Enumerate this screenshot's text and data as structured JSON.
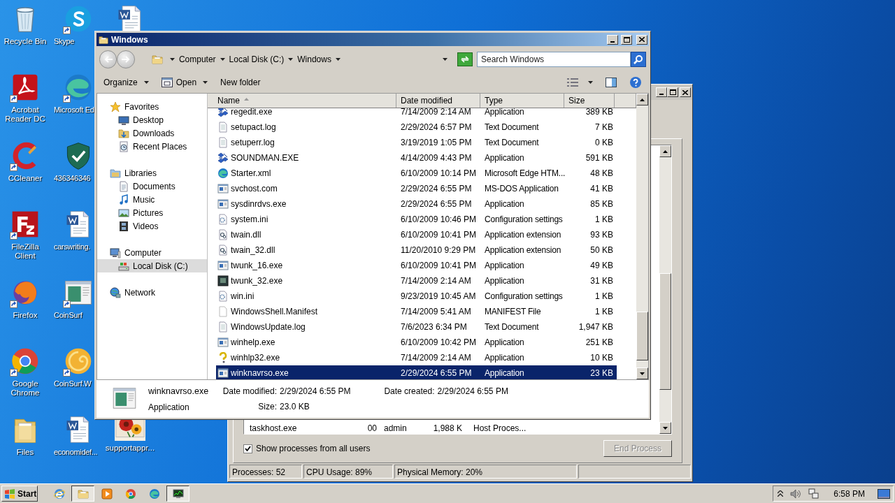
{
  "desktop": {
    "columns": [
      [
        {
          "label": "Recycle Bin",
          "kind": "recycle",
          "shortcut": false
        },
        {
          "label": "Acrobat Reader DC",
          "kind": "acrobat",
          "shortcut": true
        },
        {
          "label": "CCleaner",
          "kind": "ccleaner",
          "shortcut": true
        },
        {
          "label": "FileZilla Client",
          "kind": "filezilla",
          "shortcut": true
        },
        {
          "label": "Firefox",
          "kind": "firefox",
          "shortcut": true
        },
        {
          "label": "Google Chrome",
          "kind": "chrome",
          "shortcut": true
        },
        {
          "label": "Files",
          "kind": "folder",
          "shortcut": false
        }
      ],
      [
        {
          "label": "Skype",
          "kind": "skype",
          "shortcut": true
        },
        {
          "label": "Microsoft Ed",
          "kind": "edge",
          "shortcut": true
        },
        {
          "label": "436346346",
          "kind": "shield",
          "shortcut": false
        },
        {
          "label": "carswriting.",
          "kind": "word",
          "shortcut": false
        },
        {
          "label": "CoinSurf",
          "kind": "app",
          "shortcut": true
        },
        {
          "label": "CoinSurf.W",
          "kind": "coin",
          "shortcut": true
        },
        {
          "label": "economidef...",
          "kind": "word",
          "shortcut": false
        }
      ],
      [
        {
          "kind": "word",
          "shortcut": false
        },
        {
          "label": "supportappr...",
          "kind": "picture",
          "shortcut": false
        }
      ]
    ]
  },
  "task_manager": {
    "process_row": [
      "taskhost.exe",
      "00",
      "admin",
      "1,988 K",
      "Host Proces..."
    ],
    "show_all_users": {
      "label": "Show processes from all users",
      "checked": true
    },
    "end_process": {
      "label": "End Process",
      "disabled": true
    },
    "status_bar": [
      "Processes: 52",
      "CPU Usage: 89%",
      "Physical Memory: 20%"
    ]
  },
  "explorer": {
    "title": "Windows",
    "breadcrumb": [
      "Computer",
      "Local Disk (C:)",
      "Windows"
    ],
    "search": {
      "placeholder": "Search Windows"
    },
    "toolbar": [
      {
        "label": "Organize",
        "kind": "menu"
      },
      {
        "label": "Open",
        "kind": "open"
      },
      {
        "label": "New folder",
        "kind": "plain"
      }
    ],
    "sidebar": [
      {
        "label": "Favorites",
        "kind": "star",
        "selected": false,
        "children": [
          {
            "label": "Desktop",
            "kind": "desktop",
            "selected": false
          },
          {
            "label": "Downloads",
            "kind": "downloads",
            "selected": false
          },
          {
            "label": "Recent Places",
            "kind": "recent",
            "selected": false
          }
        ]
      },
      {
        "label": "Libraries",
        "kind": "libraries",
        "selected": false,
        "children": [
          {
            "label": "Documents",
            "kind": "doc",
            "selected": false
          },
          {
            "label": "Music",
            "kind": "music",
            "selected": false
          },
          {
            "label": "Pictures",
            "kind": "pictures",
            "selected": false
          },
          {
            "label": "Videos",
            "kind": "videos",
            "selected": false
          }
        ]
      },
      {
        "label": "Computer",
        "kind": "computer",
        "selected": false,
        "children": [
          {
            "label": "Local Disk (C:)",
            "kind": "disk",
            "selected": true
          }
        ]
      },
      {
        "label": "Network",
        "kind": "network",
        "selected": false
      }
    ],
    "columns": [
      {
        "label": "Name",
        "sorted": true
      },
      {
        "label": "Date modified",
        "sorted": false
      },
      {
        "label": "Type",
        "sorted": false
      },
      {
        "label": "Size",
        "sorted": false
      }
    ],
    "rows": [
      {
        "kind": "regedit",
        "name": "regedit.exe",
        "date": "7/14/2009 2:14 AM",
        "type": "Application",
        "size": "389 KB",
        "selected": false
      },
      {
        "kind": "text",
        "name": "setupact.log",
        "date": "2/29/2024 6:57 PM",
        "type": "Text Document",
        "size": "7 KB",
        "selected": false
      },
      {
        "kind": "text",
        "name": "setuperr.log",
        "date": "3/19/2019 1:05 PM",
        "type": "Text Document",
        "size": "0 KB",
        "selected": false
      },
      {
        "kind": "regedit",
        "name": "SOUNDMAN.EXE",
        "date": "4/14/2009 4:43 PM",
        "type": "Application",
        "size": "591 KB",
        "selected": false
      },
      {
        "kind": "edge",
        "name": "Starter.xml",
        "date": "6/10/2009 10:14 PM",
        "type": "Microsoft Edge HTM...",
        "size": "48 KB",
        "selected": false
      },
      {
        "kind": "app",
        "name": "svchost.com",
        "date": "2/29/2024 6:55 PM",
        "type": "MS-DOS Application",
        "size": "41 KB",
        "selected": false
      },
      {
        "kind": "app",
        "name": "sysdinrdvs.exe",
        "date": "2/29/2024 6:55 PM",
        "type": "Application",
        "size": "85 KB",
        "selected": false
      },
      {
        "kind": "ini",
        "name": "system.ini",
        "date": "6/10/2009 10:46 PM",
        "type": "Configuration settings",
        "size": "1 KB",
        "selected": false
      },
      {
        "kind": "dll",
        "name": "twain.dll",
        "date": "6/10/2009 10:41 PM",
        "type": "Application extension",
        "size": "93 KB",
        "selected": false
      },
      {
        "kind": "dll",
        "name": "twain_32.dll",
        "date": "11/20/2010 9:29 PM",
        "type": "Application extension",
        "size": "50 KB",
        "selected": false
      },
      {
        "kind": "app",
        "name": "twunk_16.exe",
        "date": "6/10/2009 10:41 PM",
        "type": "Application",
        "size": "49 KB",
        "selected": false
      },
      {
        "kind": "dark",
        "name": "twunk_32.exe",
        "date": "7/14/2009 2:14 AM",
        "type": "Application",
        "size": "31 KB",
        "selected": false
      },
      {
        "kind": "ini",
        "name": "win.ini",
        "date": "9/23/2019 10:45 AM",
        "type": "Configuration settings",
        "size": "1 KB",
        "selected": false
      },
      {
        "kind": "blank",
        "name": "WindowsShell.Manifest",
        "date": "7/14/2009 5:41 AM",
        "type": "MANIFEST File",
        "size": "1 KB",
        "selected": false
      },
      {
        "kind": "text",
        "name": "WindowsUpdate.log",
        "date": "7/6/2023 6:34 PM",
        "type": "Text Document",
        "size": "1,947 KB",
        "selected": false
      },
      {
        "kind": "app",
        "name": "winhelp.exe",
        "date": "6/10/2009 10:42 PM",
        "type": "Application",
        "size": "251 KB",
        "selected": false
      },
      {
        "kind": "help",
        "name": "winhlp32.exe",
        "date": "7/14/2009 2:14 AM",
        "type": "Application",
        "size": "10 KB",
        "selected": false
      },
      {
        "kind": "app",
        "name": "winknavrso.exe",
        "date": "2/29/2024 6:55 PM",
        "type": "Application",
        "size": "23 KB",
        "selected": true
      }
    ],
    "details": {
      "name": "winknavrso.exe",
      "type": "Application",
      "field_columns": [
        [
          {
            "label": "Date modified:",
            "value": "2/29/2024 6:55 PM"
          },
          {
            "label": "Size:",
            "value": "23.0 KB"
          }
        ],
        [
          {
            "label": "Date created:",
            "value": "2/29/2024 6:55 PM"
          }
        ]
      ]
    }
  },
  "taskbar": {
    "start": "Start",
    "items": [
      {
        "kind": "ie",
        "active": false
      },
      {
        "kind": "folder",
        "active": true
      },
      {
        "kind": "media",
        "active": false
      },
      {
        "kind": "chrome",
        "active": false
      },
      {
        "kind": "edge",
        "active": false
      },
      {
        "kind": "taskmgr",
        "active": true
      }
    ],
    "clock": "6:58 PM"
  }
}
